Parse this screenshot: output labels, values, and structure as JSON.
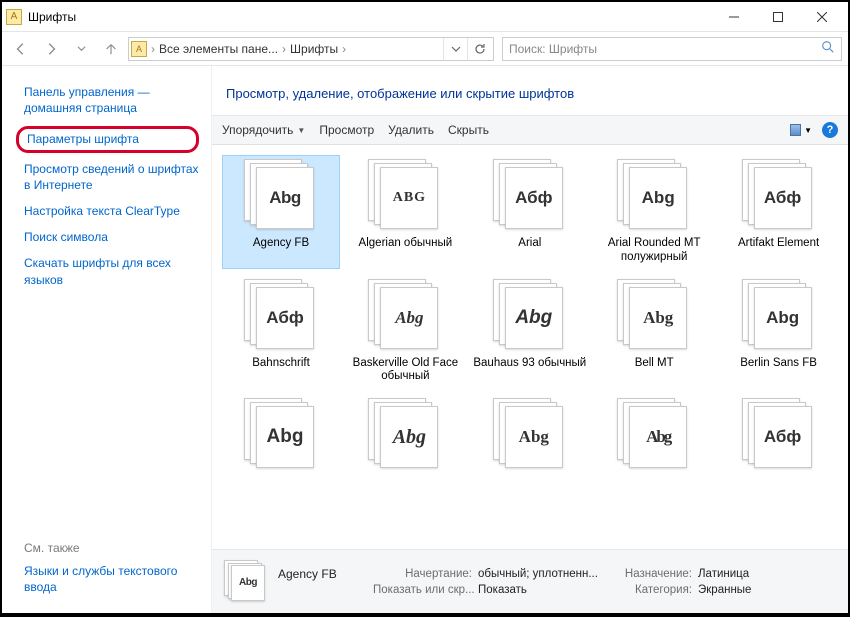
{
  "title": "Шрифты",
  "breadcrumb": {
    "seg1": "Все элементы пане...",
    "seg2": "Шрифты"
  },
  "search_placeholder": "Поиск: Шрифты",
  "sidebar": {
    "home": "Панель управления — домашняя страница",
    "params": "Параметры шрифта",
    "info": "Просмотр сведений о шрифтах в Интернете",
    "cleartype": "Настройка текста ClearType",
    "symbol": "Поиск символа",
    "download": "Скачать шрифты для всех языков",
    "seealso": "См. также",
    "textinput": "Языки и службы текстового ввода"
  },
  "heading": "Просмотр, удаление, отображение или скрытие шрифтов",
  "toolbar": {
    "organize": "Упорядочить",
    "preview": "Просмотр",
    "delete": "Удалить",
    "hide": "Скрыть"
  },
  "fonts": [
    {
      "label": "Agency FB",
      "sample": "Abg",
      "cls": "s-agency",
      "selected": true
    },
    {
      "label": "Algerian обычный",
      "sample": "ABG",
      "cls": "s-algerian"
    },
    {
      "label": "Arial",
      "sample": "Абф",
      "cls": "s-arial"
    },
    {
      "label": "Arial Rounded MT полужирный",
      "sample": "Abg",
      "cls": "s-arialr"
    },
    {
      "label": "Artifakt Element",
      "sample": "Абф",
      "cls": "s-artifakt"
    },
    {
      "label": "Bahnschrift",
      "sample": "Абф",
      "cls": "s-bahn"
    },
    {
      "label": "Baskerville Old Face обычный",
      "sample": "Abg",
      "cls": "s-bask"
    },
    {
      "label": "Bauhaus 93 обычный",
      "sample": "Abg",
      "cls": "s-bauhaus"
    },
    {
      "label": "Bell MT",
      "sample": "Abg",
      "cls": "s-bell"
    },
    {
      "label": "Berlin Sans FB",
      "sample": "Abg",
      "cls": "s-berlin"
    },
    {
      "label": "",
      "sample": "Abg",
      "cls": "s-bernard"
    },
    {
      "label": "",
      "sample": "Abg",
      "cls": "s-black"
    },
    {
      "label": "",
      "sample": "Abg",
      "cls": "s-bodoni"
    },
    {
      "label": "",
      "sample": "Abg",
      "cls": "s-bodcond"
    },
    {
      "label": "",
      "sample": "Абф",
      "cls": "s-arial"
    }
  ],
  "details": {
    "name": "Agency FB",
    "sample": "Abg",
    "k_style": "Начертание:",
    "v_style": "обычный; уплотненн...",
    "k_show": "Показать или скр...",
    "v_show": "Показать",
    "k_design": "Назначение:",
    "v_design": "Латиница",
    "k_cat": "Категория:",
    "v_cat": "Экранные"
  }
}
